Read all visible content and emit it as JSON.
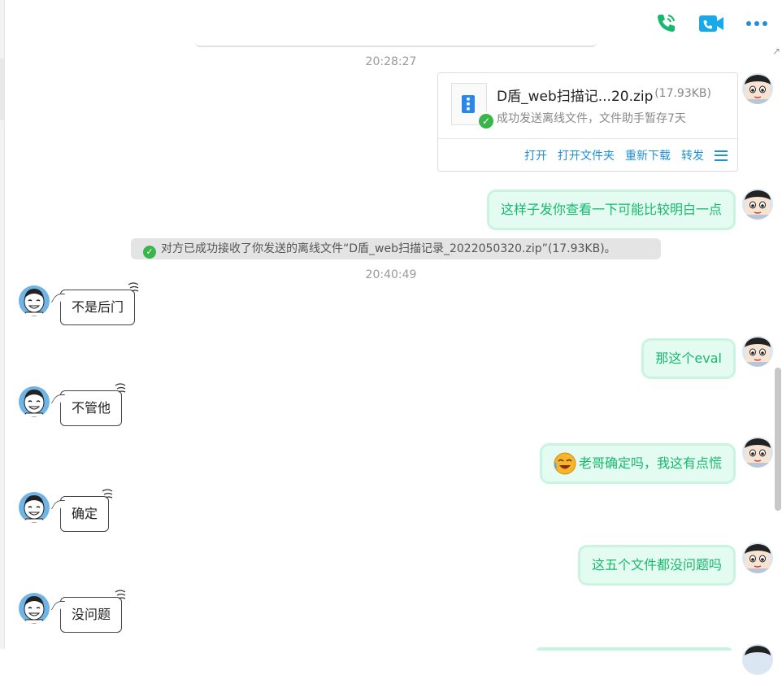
{
  "toolbar": {
    "icons": [
      "phone-icon",
      "video-call-icon",
      "more-icon"
    ]
  },
  "timestamps": [
    "20:28:27",
    "20:40:49"
  ],
  "file_message": {
    "name": "D盾_web扫描记...20.zip",
    "size": "(17.93KB)",
    "status": "成功发送离线文件，文件助手暂存7天",
    "actions": [
      "打开",
      "打开文件夹",
      "重新下载",
      "转发"
    ]
  },
  "system_notice": "对方已成功接收了你发送的离线文件“D盾_web扫描记录_2022050320.zip”(17.93KB)。",
  "messages": [
    {
      "side": "right",
      "text": "这样子发你查看一下可能比较明白一点"
    },
    {
      "side": "left",
      "text": "不是后门"
    },
    {
      "side": "right",
      "text": "那这个eval"
    },
    {
      "side": "left",
      "text": "不管他"
    },
    {
      "side": "right",
      "text": "老哥确定吗，我这有点慌",
      "emoji": "laughing-crying-emoji"
    },
    {
      "side": "left",
      "text": "确定"
    },
    {
      "side": "right",
      "text": "这五个文件都没问题吗"
    },
    {
      "side": "left",
      "text": "没问题"
    }
  ],
  "colors": {
    "accent": "#1e90d6",
    "self_bubble_text": "#19b86f",
    "self_bubble_bg": "#e3fbf0",
    "success": "#39b54a",
    "phone": "#19b86f",
    "video": "#1aa9e8"
  }
}
